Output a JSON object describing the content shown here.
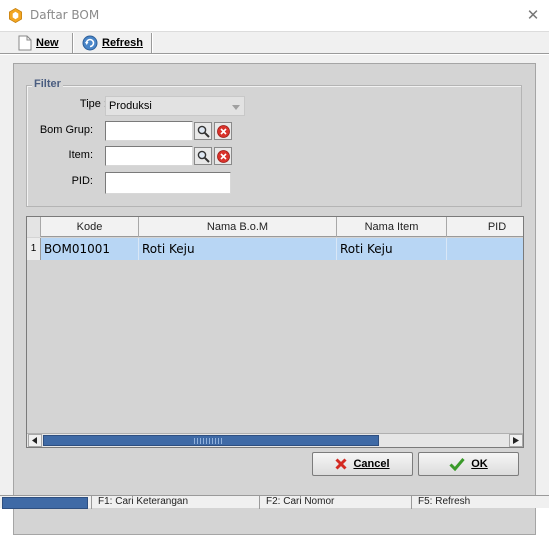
{
  "window": {
    "title": "Daftar BOM",
    "close_glyph": "✕"
  },
  "toolbar": {
    "new_label": "New",
    "refresh_label": "Refresh"
  },
  "filter": {
    "legend": "Filter",
    "tipe_label": "Tipe :",
    "tipe_value": "Produksi",
    "bom_grup_label": "Bom Grup:",
    "bom_grup_value": "",
    "item_label": "Item:",
    "item_value": "",
    "pid_label": "PID:",
    "pid_value": ""
  },
  "table": {
    "columns": [
      "Kode",
      "Nama B.o.M",
      "Nama Item",
      "PID"
    ],
    "rows": [
      {
        "num": "1",
        "kode": "BOM01001",
        "nama_bom": "Roti Keju",
        "nama_item": "Roti Keju",
        "pid": ""
      }
    ]
  },
  "buttons": {
    "cancel_label": "Cancel",
    "ok_label": "OK"
  },
  "statusbar": {
    "f1": "F1: Cari Keterangan",
    "f2": "F2: Cari Nomor",
    "f5": "F5: Refresh"
  },
  "colors": {
    "selected_row": "#b8d6f4",
    "accent_blue": "#3f6aa6",
    "legend_text": "#4a5d80"
  },
  "icons": {
    "title": "app-hexagon-icon",
    "new": "new-document-icon",
    "refresh": "refresh-icon",
    "search": "magnifier-icon",
    "clear": "red-clear-icon",
    "cancel": "red-x-icon",
    "ok": "green-check-icon"
  }
}
